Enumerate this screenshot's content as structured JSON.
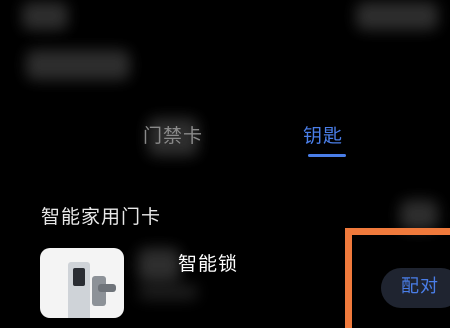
{
  "tabs": [
    {
      "label": "门禁卡",
      "active": false
    },
    {
      "label": "钥匙",
      "active": true
    }
  ],
  "section": {
    "title": "智能家用门卡"
  },
  "device": {
    "name": "智能锁",
    "image_icon": "smart-lock-icon",
    "action_label": "配对"
  },
  "colors": {
    "background": "#000000",
    "accent": "#4a7ee8",
    "highlight": "#f07a3c",
    "button_bg": "#1f2430"
  }
}
